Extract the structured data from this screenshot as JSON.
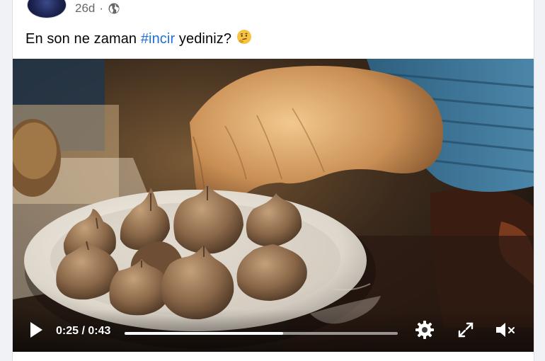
{
  "post": {
    "age": "26d",
    "separator": "·",
    "privacy_icon": "globe-icon",
    "caption_before": "En son ne zaman ",
    "caption_hashtag": "#incir",
    "caption_after": " yediniz?",
    "caption_emoji": "thinking-face-icon"
  },
  "video": {
    "current_time": "0:25",
    "time_separator": " / ",
    "duration": "0:43",
    "progress": 0.58,
    "controls": {
      "play_icon": "play-icon",
      "settings_icon": "gear-icon",
      "fullscreen_icon": "fullscreen-icon",
      "mute_icon": "speaker-muted-icon"
    }
  },
  "colors": {
    "hashtag": "#216fdb",
    "meta_text": "#65676b",
    "background": "#f0f2f5"
  }
}
